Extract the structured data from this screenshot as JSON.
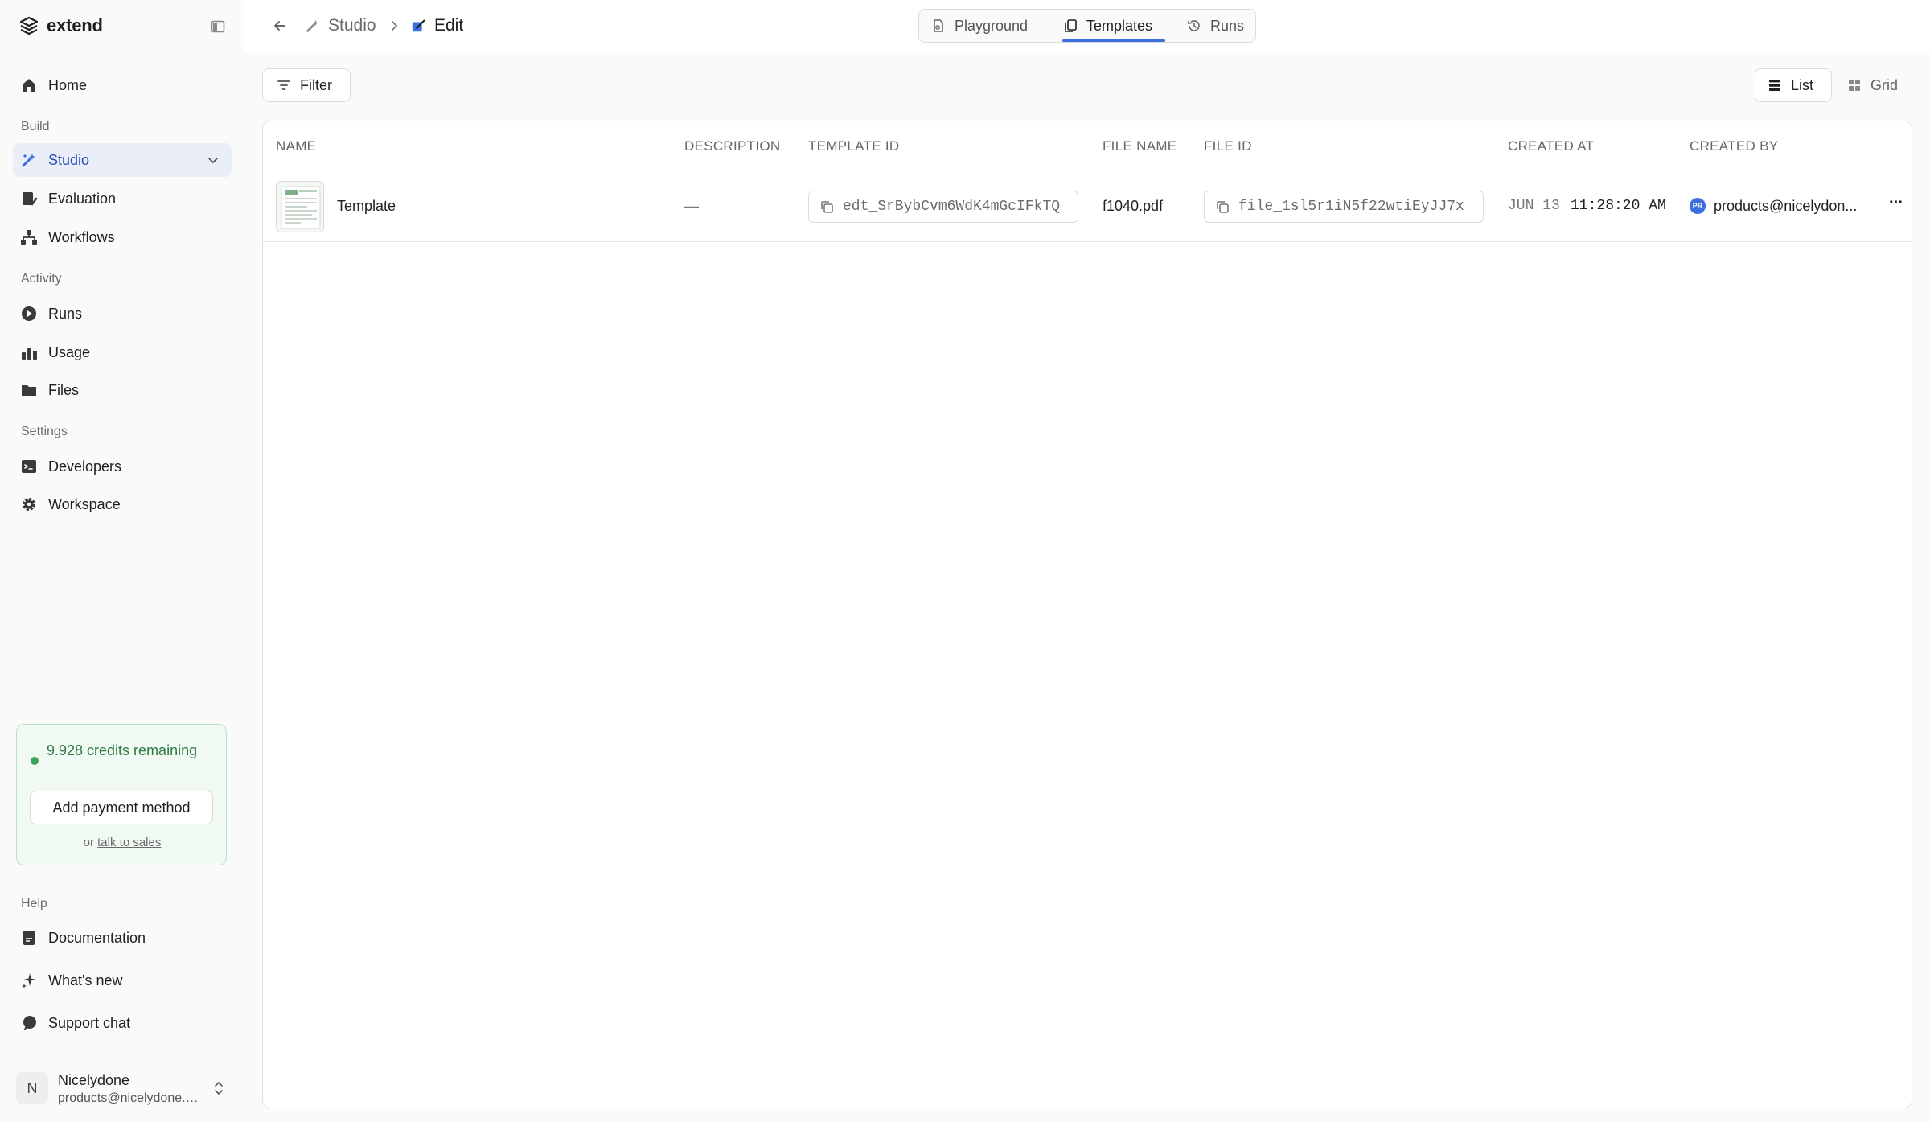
{
  "app": {
    "name": "extend"
  },
  "sidebar": {
    "items": {
      "home": "Home",
      "studio": "Studio",
      "evaluation": "Evaluation",
      "workflows": "Workflows",
      "runs": "Runs",
      "usage": "Usage",
      "files": "Files",
      "developers": "Developers",
      "workspace": "Workspace",
      "documentation": "Documentation",
      "whats_new": "What's new",
      "support_chat": "Support chat"
    },
    "sections": {
      "build": "Build",
      "activity": "Activity",
      "settings": "Settings",
      "help": "Help"
    },
    "credits": {
      "text": "9.928 credits remaining",
      "button": "Add payment method",
      "prefix": "or",
      "link": "talk to sales"
    },
    "user": {
      "initial": "N",
      "name": "Nicelydone",
      "email": "products@nicelydone.club"
    }
  },
  "header": {
    "breadcrumb": {
      "studio": "Studio",
      "edit": "Edit"
    },
    "tabs": {
      "playground": "Playground",
      "templates": "Templates",
      "runs": "Runs"
    }
  },
  "toolbar": {
    "filter": "Filter",
    "list": "List",
    "grid": "Grid"
  },
  "table": {
    "columns": {
      "name": "NAME",
      "description": "DESCRIPTION",
      "template_id": "TEMPLATE ID",
      "file_name": "FILE NAME",
      "file_id": "FILE ID",
      "created_at": "CREATED AT",
      "created_by": "CREATED BY"
    },
    "rows": [
      {
        "name": "Template",
        "description": "—",
        "template_id": "edt_SrBybCvm6WdK4mGcIFkTQ",
        "file_name": "f1040.pdf",
        "file_id": "file_1sl5r1iN5f22wtiEyJJ7x",
        "created_date": "JUN 13",
        "created_time": "11:28:20 AM",
        "created_by_initials": "PR",
        "created_by": "products@nicelydon...",
        "more": "···"
      }
    ]
  },
  "colors": {
    "accent": "#3b6fe0",
    "active_bg": "#e9eef8",
    "credits_green": "#2f7a45"
  }
}
